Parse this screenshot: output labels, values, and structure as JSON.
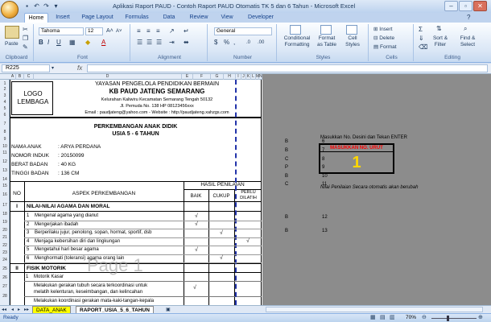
{
  "window": {
    "title": "Aplikasi Raport PAUD - Contoh Raport PAUD Otomatis TK 5 dan 6 Tahun - Microsoft Excel"
  },
  "tabs": [
    "Home",
    "Insert",
    "Page Layout",
    "Formulas",
    "Data",
    "Review",
    "View",
    "Developer"
  ],
  "ribbon": {
    "clipboard": {
      "paste": "Paste",
      "label": "Clipboard"
    },
    "font": {
      "name": "Tahoma",
      "size": "12",
      "label": "Font"
    },
    "alignment": {
      "label": "Alignment"
    },
    "number": {
      "format": "General",
      "label": "Number"
    },
    "styles": {
      "conditional": "Conditional Formatting",
      "format_table": "Format as Table",
      "cell_styles": "Cell Styles",
      "label": "Styles"
    },
    "cells": {
      "insert": "Insert",
      "delete": "Delete",
      "format": "Format",
      "label": "Cells"
    },
    "editing": {
      "sort": "Sort & Filter",
      "find": "Find & Select",
      "label": "Editing"
    }
  },
  "formula_bar": {
    "name_box": "R225",
    "fx": "fx",
    "value": ""
  },
  "columns": [
    "A",
    "B",
    "C",
    "D",
    "E",
    "F",
    "G",
    "H",
    "I",
    "J",
    "K",
    "L",
    "M",
    "N",
    "O"
  ],
  "rows": [
    "1",
    "2",
    "3",
    "4",
    "5",
    "6",
    "7",
    "8",
    "9",
    "10",
    "11",
    "12",
    "13",
    "14",
    "15",
    "16",
    "17",
    "18",
    "19",
    "20",
    "21",
    "22",
    "23",
    "24",
    "25",
    "26",
    "27",
    "28"
  ],
  "report": {
    "logo": "LOGO LEMBAGA",
    "foundation": "YAYASAN PENGELOLA PENDIDIKAN BERMAIN",
    "school": "KB PAUD JATENG SEMARANG",
    "address1": "Kelurahan Kaliwiru Kecamatan Semarang Tengah 50132",
    "address2": "Jl. Pemuda No. 138 HP 08123456xxx",
    "email": "Email : paudjateng@yahoo.com - Website : http://paudjateng.xahzgs.com",
    "title": "PERKEMBANGAN ANAK DIDIK",
    "subtitle": "USIA 5 - 6 TAHUN",
    "fields": [
      {
        "label": "NAMA ANAK",
        "value": ": ARYA PERDANA"
      },
      {
        "label": "NOMOR INDUK",
        "value": ": 20150099"
      },
      {
        "label": "BERAT BADAN",
        "value": ": 40 KG"
      },
      {
        "label": "TINGGI BADAN",
        "value": ": 136 CM"
      }
    ],
    "table_head": {
      "no": "NO",
      "aspek": "ASPEK PERKEMBANGAN",
      "hasil": "HASIL PENILAIAN",
      "baik": "BAIK",
      "cukup": "CUKUP",
      "perlu": "PERLU DILATIH"
    },
    "section1": {
      "no": "I",
      "title": "NILAI-NILAI AGAMA DAN MORAL"
    },
    "items1": [
      {
        "no": "1",
        "text": "Mengenal agama yang dianut",
        "mark": "baik"
      },
      {
        "no": "2",
        "text": "Mengerjakan ibadah",
        "mark": "baik"
      },
      {
        "no": "3",
        "text": "Berperilaku jujur, penolong, sopan, hormat, sportif, dsb",
        "mark": "cukup"
      },
      {
        "no": "4",
        "text": "Menjaga kebersihan diri dan lingkungan",
        "mark": "perlu"
      },
      {
        "no": "5",
        "text": "Mengetahui hari besar agama",
        "mark": "baik"
      },
      {
        "no": "6",
        "text": "Menghormati (toleransi) agama orang lain",
        "mark": "cukup"
      }
    ],
    "section2": {
      "no": "II",
      "title": "FISIK MOTORIK"
    },
    "sub_motorik": {
      "no": "1",
      "text": "Motorik Kasar"
    },
    "motorik_items": [
      {
        "text": "Melakukan gerakan tubuh secara terkoordinasi untuk"
      },
      {
        "text": "melatih kelenturan, keseimbangan, dan kelincahan"
      },
      {
        "text": "Melakukan koordinasi gerakan mata-kaki-tangan-kepala"
      }
    ],
    "watermark": "Page 1"
  },
  "side": {
    "instruction": "Masukkan No. Desini dan Tekan ENTER",
    "box_label": "MASUKKAN NO. URUT",
    "box_value": "1",
    "note": "Nilai Penilaian Secara otomatis akan berubah",
    "grades": [
      {
        "k": "B",
        "l": "6"
      },
      {
        "k": "B",
        "l": "7"
      },
      {
        "k": "C",
        "l": "8"
      },
      {
        "k": "P",
        "l": "9"
      },
      {
        "k": "B",
        "l": "10"
      },
      {
        "k": "C",
        "l": "11"
      },
      {
        "k": "B",
        "l": "12"
      },
      {
        "k": "B",
        "l": "13"
      }
    ]
  },
  "sheet_tabs": [
    "DATA_ANAK",
    "RAPORT_USIA_5_6_TAHUN"
  ],
  "status": {
    "ready": "Ready",
    "zoom": "70%"
  },
  "colors": {
    "accent": "#15428b",
    "selected_tab": "#ffff00",
    "box_border": "#000000",
    "box_label": "#ff0000",
    "box_value": "#ffd700"
  }
}
